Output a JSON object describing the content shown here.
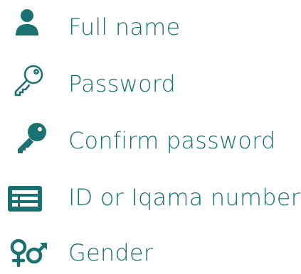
{
  "colors": {
    "accent": "#1a7171",
    "background": "#ffffff"
  },
  "fields": [
    {
      "icon": "user-icon",
      "label": "Full name"
    },
    {
      "icon": "key-outline-icon",
      "label": "Password"
    },
    {
      "icon": "key-filled-icon",
      "label": "Confirm password"
    },
    {
      "icon": "id-card-icon",
      "label": "ID or Iqama number"
    },
    {
      "icon": "gender-icon",
      "label": "Gender"
    }
  ]
}
